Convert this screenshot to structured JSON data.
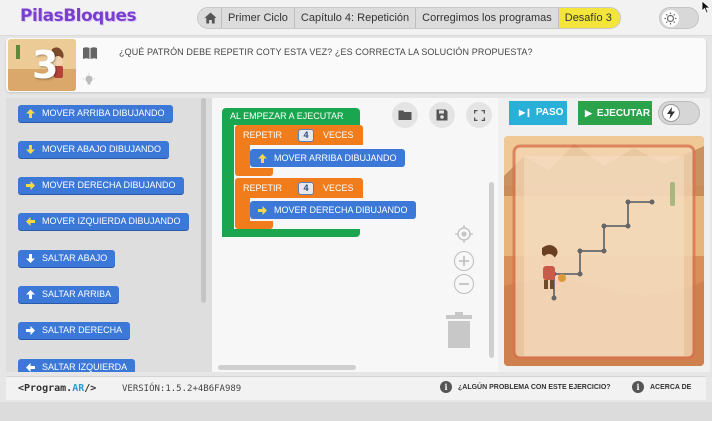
{
  "app": {
    "logo": "PilasBloques"
  },
  "breadcrumb": {
    "items": [
      {
        "label": "Primer Ciclo"
      },
      {
        "label": "Capítulo 4: Repetición"
      },
      {
        "label": "Corregimos los programas"
      },
      {
        "label": "Desafío 3"
      }
    ]
  },
  "challenge": {
    "number": "3",
    "statement": "¿QUÉ PATRÓN DEBE REPETIR COTY ESTA VEZ? ¿ES CORRECTA LA SOLUCIÓN PROPUESTA?"
  },
  "toolbox": {
    "blocks": [
      {
        "label": "MOVER ARRIBA DIBUJANDO",
        "icon": "arrow-up-icon"
      },
      {
        "label": "MOVER ABAJO DIBUJANDO",
        "icon": "arrow-down-icon"
      },
      {
        "label": "MOVER DERECHA DIBUJANDO",
        "icon": "arrow-right-icon"
      },
      {
        "label": "MOVER IZQUIERDA DIBUJANDO",
        "icon": "arrow-left-icon"
      },
      {
        "label": "SALTAR ABAJO",
        "icon": "arrow-down-icon"
      },
      {
        "label": "SALTAR ARRIBA",
        "icon": "arrow-up-icon"
      },
      {
        "label": "SALTAR DERECHA",
        "icon": "arrow-right-icon"
      },
      {
        "label": "SALTAR IZQUIERDA",
        "icon": "arrow-left-icon"
      }
    ]
  },
  "program": {
    "start_label": "AL EMPEZAR A EJECUTAR",
    "repeat1": {
      "label": "REPETIR",
      "count": "4",
      "suffix": "VECES",
      "inner": "MOVER ARRIBA DIBUJANDO"
    },
    "repeat2": {
      "label": "REPETIR",
      "count": "4",
      "suffix": "VECES",
      "inner": "MOVER DERECHA DIBUJANDO"
    }
  },
  "controls": {
    "step_label": "PASO",
    "run_label": "EJECUTAR"
  },
  "footer": {
    "logo_left": "<Program.",
    "logo_ar": "AR",
    "logo_right": "/>",
    "version": "VERSIÓN:1.5.2+4B6FA989",
    "problem_link": "¿ALGÚN PROBLEMA CON ESTE EJERCICIO?",
    "about_link": "ACERCA DE"
  },
  "colors": {
    "motion_block": "#3c78d8",
    "repeat_block": "#f07c1b",
    "event_block": "#1aa64f",
    "step_button": "#29b0d8",
    "run_button": "#2aa34a",
    "active_crumb": "#f3e53c",
    "logo": "#7b3fd0"
  }
}
